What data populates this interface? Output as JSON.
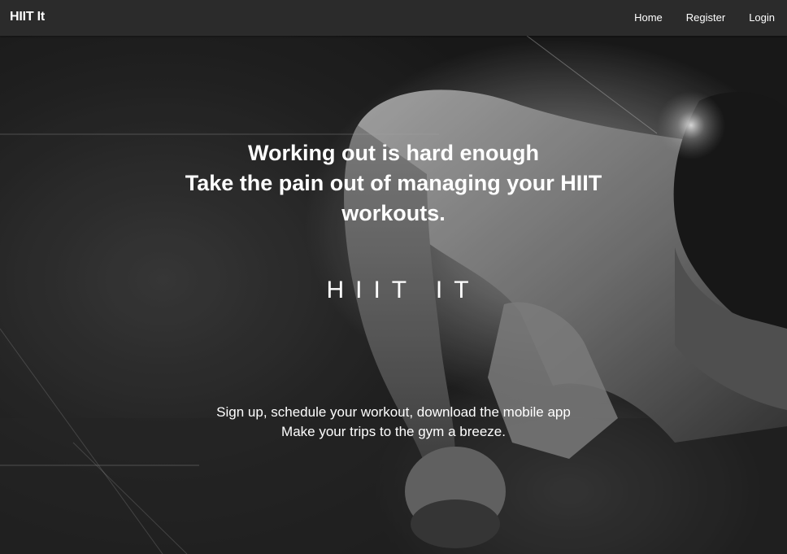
{
  "navbar": {
    "brand": "HIIT It",
    "links": [
      "Home",
      "Register",
      "Login"
    ]
  },
  "hero": {
    "headline_line1": "Working out is hard enough",
    "headline_line2": "Take the pain out of managing your HIIT workouts.",
    "logo_text": "HIIT IT",
    "tagline_line1": "Sign up, schedule your workout, download the mobile app",
    "tagline_line2": "Make your trips to the gym a breeze."
  },
  "colors": {
    "navbar_bg": "#2b2b2b",
    "text": "#ffffff"
  }
}
